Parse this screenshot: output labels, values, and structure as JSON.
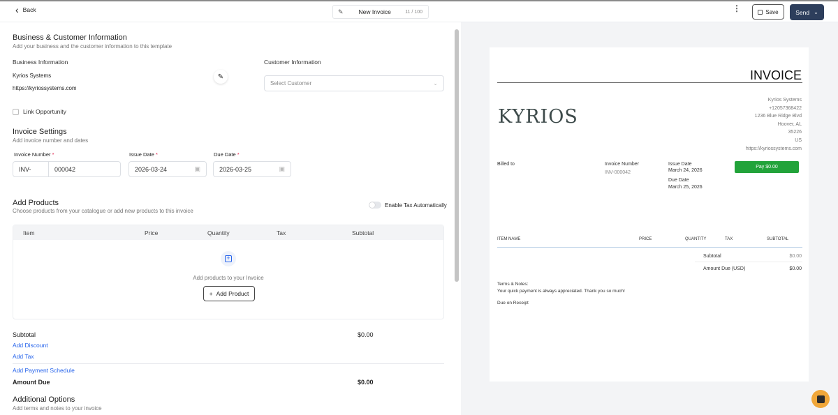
{
  "topbar": {
    "back": "Back",
    "title": "New Invoice",
    "title_count": "11 / 100",
    "save": "Save",
    "send": "Send"
  },
  "business_section": {
    "title": "Business & Customer Information",
    "subtitle": "Add your business and the customer information to this template",
    "business_label": "Business Information",
    "business_name": "Kyrios Systems",
    "business_url": "https://kyriossystems.com",
    "customer_label": "Customer Information",
    "customer_placeholder": "Select Customer",
    "link_opportunity": "Link Opportunity"
  },
  "invoice_settings": {
    "title": "Invoice Settings",
    "subtitle": "Add invoice number and dates",
    "number_label": "Invoice Number",
    "number_prefix": "INV-",
    "number_value": "000042",
    "issue_label": "Issue Date",
    "issue_value": "2026-03-24",
    "due_label": "Due Date",
    "due_value": "2026-03-25",
    "required": "*"
  },
  "products": {
    "title": "Add Products",
    "subtitle": "Choose products from your catalogue or add new products to this invoice",
    "tax_toggle": "Enable Tax Automatically",
    "tax_enabled": false,
    "columns": [
      "Item",
      "Price",
      "Quantity",
      "Tax",
      "Subtotal"
    ],
    "empty_text": "Add products to your Invoice",
    "add_button": "Add Product"
  },
  "totals": {
    "subtotal_label": "Subtotal",
    "subtotal_value": "$0.00",
    "add_discount": "Add Discount",
    "add_tax": "Add Tax",
    "add_payment_schedule": "Add Payment Schedule",
    "amount_due_label": "Amount Due",
    "amount_due_value": "$0.00"
  },
  "additional": {
    "title": "Additional Options",
    "subtitle": "Add terms and notes to your invoice"
  },
  "preview": {
    "heading": "INVOICE",
    "logo": "KYRIOS",
    "company": [
      "Kyrios Systems",
      "+12057368422",
      "1236 Blue Ridge Blvd",
      "Hoover, AL",
      "35226",
      "US",
      "https://kyriossystems.com"
    ],
    "billed_to": "Billed to",
    "invoice_number_label": "Invoice Number",
    "invoice_number": "INV-000042",
    "issue_label": "Issue Date",
    "issue_date": "March 24, 2026",
    "due_label": "Due Date",
    "due_date": "March 25, 2026",
    "pay_button": "Pay $0.00",
    "columns": [
      "ITEM NAME",
      "PRICE",
      "QUANTITY",
      "TAX",
      "SUBTOTAL"
    ],
    "subtotal_label": "Subtotal",
    "subtotal_value": "$0.00",
    "amount_due_label": "Amount Due (USD)",
    "amount_due_value": "$0.00",
    "terms_label": "Terms & Notes:",
    "terms_text": "Your quick payment is always appreciated. Thank you so much!",
    "due_terms": "Due on Receipt"
  },
  "colors": {
    "primary": "#2d3e5c",
    "link": "#2563eb",
    "pay": "#22a33a",
    "chat": "#f0a73a"
  }
}
